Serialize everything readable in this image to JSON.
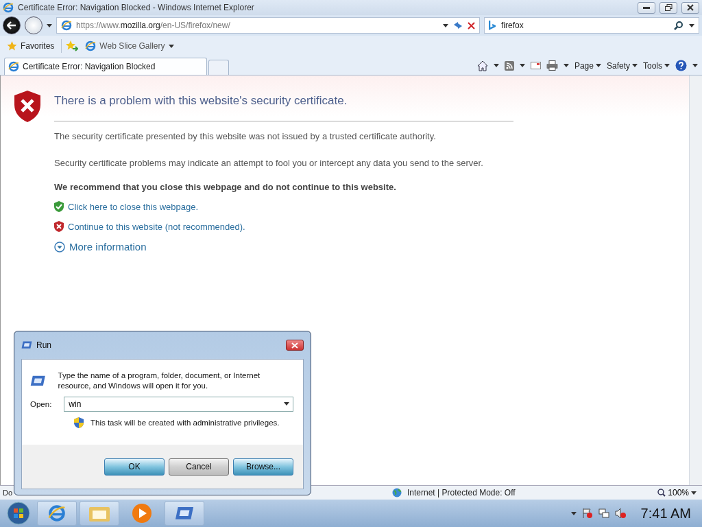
{
  "window": {
    "title": "Certificate Error: Navigation Blocked - Windows Internet Explorer"
  },
  "address_bar": {
    "url": "https://www.**mozilla.org**/en-US/firefox/new/"
  },
  "search": {
    "value": "firefox"
  },
  "favorites_bar": {
    "favorites": "Favorites",
    "web_slice": "Web Slice Gallery"
  },
  "tabs": [
    {
      "label": "Certificate Error: Navigation Blocked",
      "selected": true
    }
  ],
  "command_bar": [
    "Page",
    "Safety",
    "Tools"
  ],
  "page": {
    "title": "There is a problem with this website's security certificate.",
    "paragraphs": [
      "The security certificate presented by this website was not issued by a trusted certificate authority.",
      "Security certificate problems may indicate an attempt to fool you or intercept any data you send to the server."
    ],
    "recommendation": "We recommend that you close this webpage and do not continue to this website.",
    "links": [
      {
        "kind": "close",
        "text": "Click here to close this webpage."
      },
      {
        "kind": "continue",
        "text": "Continue to this website (not recommended)."
      }
    ],
    "more_info": "More information"
  },
  "status_bar": {
    "text": "Do",
    "zone": "Internet | Protected Mode: Off",
    "zoom": "100%"
  },
  "run_dialog": {
    "title": "Run",
    "description": "Type the name of a program, folder, document, or Internet resource, and Windows will open it for you.",
    "open_label": "Open:",
    "value": "win",
    "admin_note": "This task will be created with administrative privileges.",
    "buttons": [
      {
        "label": "OK",
        "highlighted": true
      },
      {
        "label": "Cancel",
        "highlighted": false
      },
      {
        "label": "Browse...",
        "highlighted": true
      }
    ]
  },
  "taskbar": {
    "clock": "7:41 AM"
  }
}
